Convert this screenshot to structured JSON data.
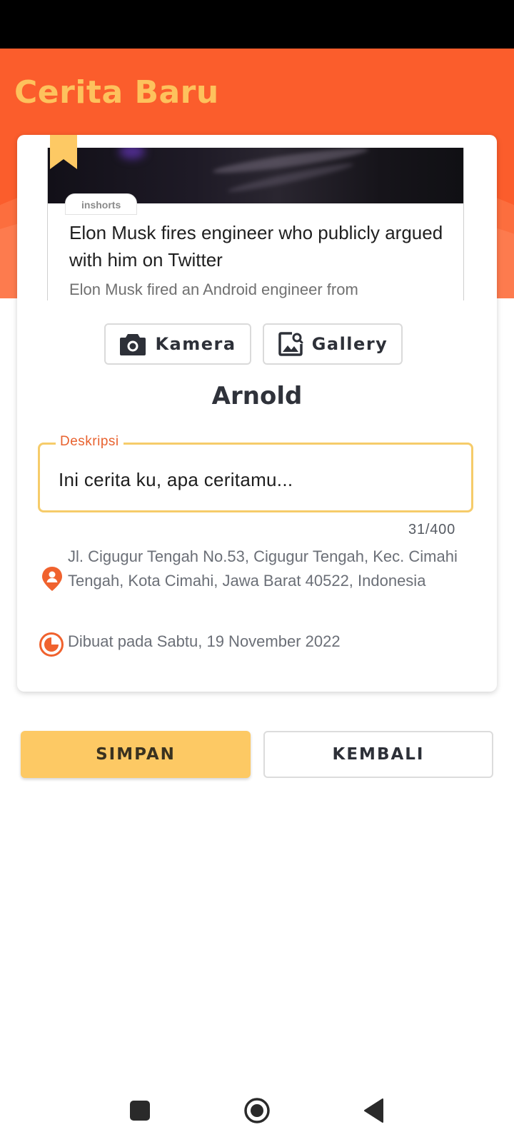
{
  "app": {
    "title": "Cerita Baru"
  },
  "preview": {
    "source": "inshorts",
    "headline": "Elon Musk fires engineer who publicly argued with him on Twitter",
    "summary": "Elon Musk fired an Android engineer from"
  },
  "media_buttons": {
    "camera_label": "Kamera",
    "gallery_label": "Gallery"
  },
  "user": {
    "name": "Arnold"
  },
  "description": {
    "label": "Deskripsi",
    "value": "Ini cerita ku, apa ceritamu...",
    "counter": "31/400"
  },
  "location": {
    "address": "Jl. Cigugur Tengah No.53, Cigugur Tengah, Kec. Cimahi Tengah, Kota Cimahi, Jawa Barat 40522, Indonesia"
  },
  "created": {
    "text": "Dibuat pada Sabtu, 19 November 2022"
  },
  "actions": {
    "save_label": "SIMPAN",
    "back_label": "KEMBALI"
  },
  "colors": {
    "header": "#fb5d2c",
    "accent_yellow": "#fdc964",
    "accent_orange": "#e8622f",
    "title_text": "#fdc25d"
  },
  "icons": [
    "bookmark-icon",
    "camera-icon",
    "gallery-icon",
    "location-pin-icon",
    "clock-icon",
    "nav-recents-icon",
    "nav-home-icon",
    "nav-back-icon"
  ]
}
